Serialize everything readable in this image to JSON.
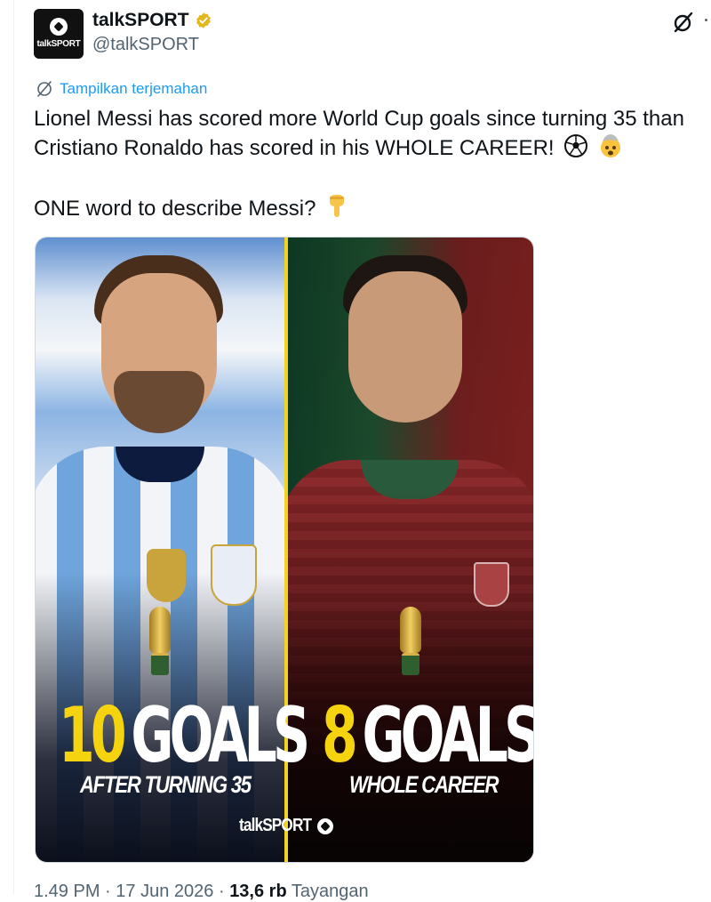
{
  "account": {
    "name": "talkSPORT",
    "handle": "@talkSPORT",
    "avatar_text": "talkSPORT",
    "verified": true,
    "verified_color": "#e2b719"
  },
  "translate": {
    "label": "Tampilkan terjemahan",
    "icon": "translate-icon"
  },
  "tweet": {
    "line1": "Lionel Messi has scored more World Cup goals since turning 35 than Cristiano Ronaldo has scored in his WHOLE CAREER!",
    "line1_emojis": [
      "soccer-ball-emoji",
      "exploding-head-emoji"
    ],
    "line2": "ONE word to describe Messi?",
    "line2_emoji": "pointing-down-emoji"
  },
  "media": {
    "left": {
      "number": "10",
      "word": "GOALS",
      "caption": "AFTER TURNING 35"
    },
    "right": {
      "number": "8",
      "word": "GOALS",
      "caption": "WHOLE CAREER"
    },
    "brand": "talkSPORT",
    "accent_color": "#f5d40f"
  },
  "meta": {
    "time": "1.49 PM",
    "date": "17 Jun 2026",
    "views_count": "13,6 rb",
    "views_label": "Tayangan",
    "separator": "·"
  },
  "colors": {
    "link": "#1d9bf0",
    "secondary": "#536471",
    "text": "#0f1419"
  }
}
